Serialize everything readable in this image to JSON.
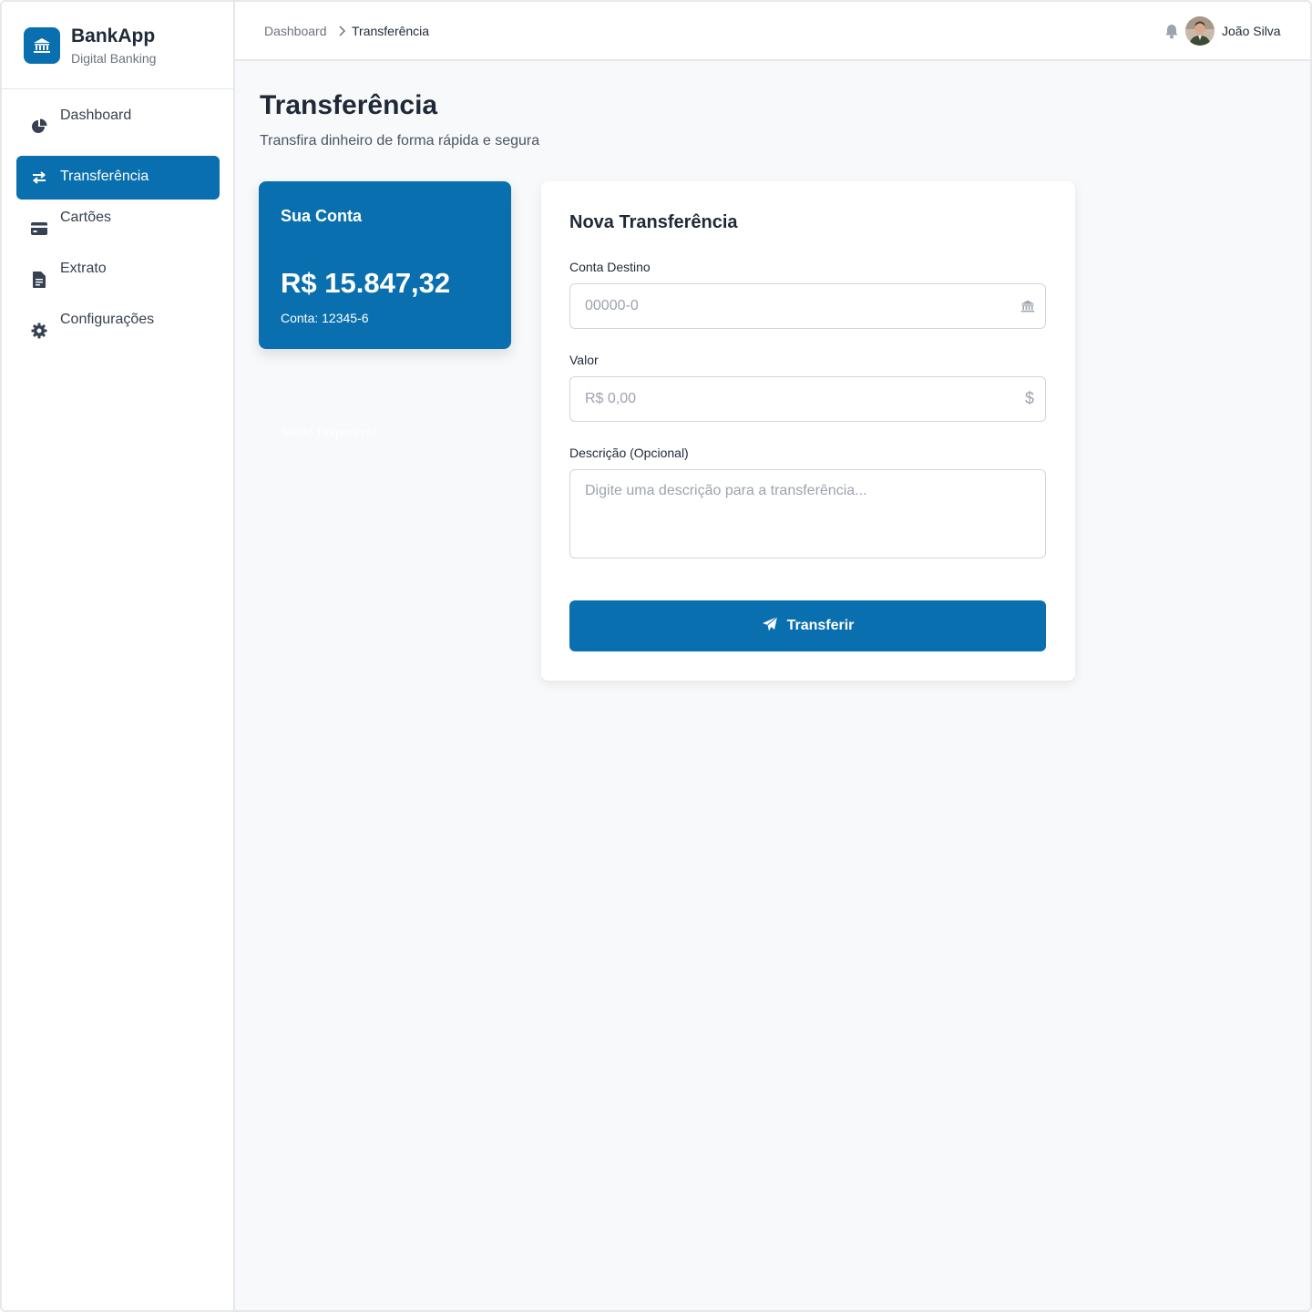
{
  "brand": {
    "title": "BankApp",
    "subtitle": "Digital Banking",
    "logo_icon": "bank-icon",
    "accent_color": "#0a6fae"
  },
  "sidebar": {
    "items": [
      {
        "label": "Dashboard",
        "icon": "pie-chart-icon",
        "active": false
      },
      {
        "label": "Transferência",
        "icon": "exchange-icon",
        "active": true
      },
      {
        "label": "Cartões",
        "icon": "credit-card-icon",
        "active": false
      },
      {
        "label": "Extrato",
        "icon": "receipt-icon",
        "active": false
      },
      {
        "label": "Configurações",
        "icon": "gear-icon",
        "active": false
      }
    ]
  },
  "header": {
    "breadcrumb": [
      "Dashboard",
      "Transferência"
    ],
    "notification_icon": "bell-icon",
    "user_name": "João Silva"
  },
  "main": {
    "title": "Transferência",
    "subtitle": "Transfira dinheiro de forma rápida e segura",
    "account_card": {
      "title": "Sua Conta",
      "balance_label": "Saldo Disponível",
      "balance": "R$ 15.847,32",
      "account_number": "Conta: 12345-6"
    },
    "form": {
      "title": "Nova Transferência",
      "destination": {
        "label": "Conta Destino",
        "placeholder": "00000-0",
        "value": "",
        "icon": "bank-icon"
      },
      "amount": {
        "label": "Valor",
        "placeholder": "R$ 0,00",
        "value": "",
        "icon": "dollar-icon"
      },
      "description": {
        "label": "Descrição (Opcional)",
        "placeholder": "Digite uma descrição para a transferência...",
        "value": ""
      },
      "submit_label": "Transferir",
      "submit_icon": "paper-plane-icon"
    }
  }
}
